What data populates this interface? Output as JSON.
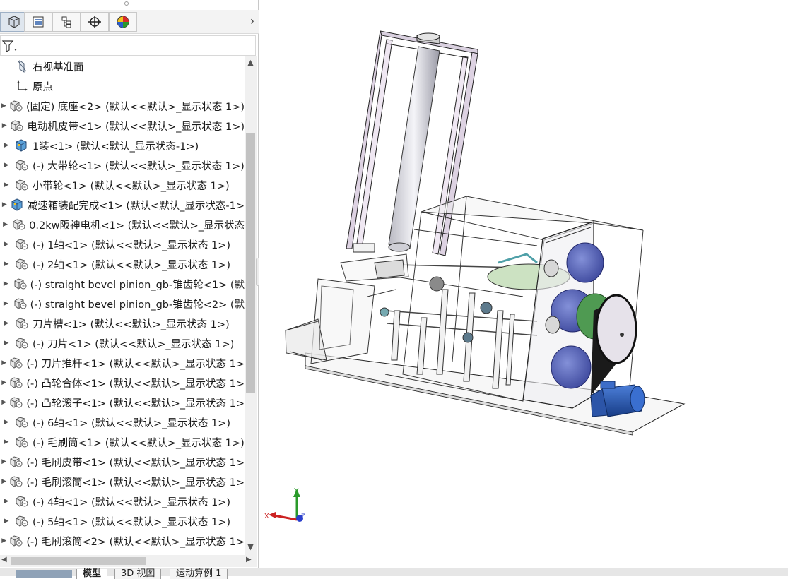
{
  "feature_tree": {
    "items": [
      {
        "label": "右视基准面",
        "icon": "plane-icon",
        "expandable": false
      },
      {
        "label": "原点",
        "icon": "origin-icon",
        "expandable": false
      },
      {
        "label": "(固定) 底座<2> (默认<<默认>_显示状态 1>)",
        "icon": "part-icon",
        "expandable": true
      },
      {
        "label": "电动机皮带<1> (默认<<默认>_显示状态 1>)",
        "icon": "part-icon",
        "expandable": true
      },
      {
        "label": "1装<1> (默认<默认_显示状态-1>)",
        "icon": "assembly-icon",
        "expandable": true
      },
      {
        "label": "(-) 大带轮<1> (默认<<默认>_显示状态 1>)",
        "icon": "part-icon",
        "expandable": true
      },
      {
        "label": "小带轮<1> (默认<<默认>_显示状态 1>)",
        "icon": "part-icon",
        "expandable": true
      },
      {
        "label": "减速箱装配完成<1> (默认<默认_显示状态-1>",
        "icon": "assembly-icon",
        "expandable": true
      },
      {
        "label": "0.2kw阪神电机<1> (默认<<默认>_显示状态",
        "icon": "part-icon",
        "expandable": true
      },
      {
        "label": "(-) 1轴<1> (默认<<默认>_显示状态 1>)",
        "icon": "part-icon",
        "expandable": true
      },
      {
        "label": "(-) 2轴<1> (默认<<默认>_显示状态 1>)",
        "icon": "part-icon",
        "expandable": true
      },
      {
        "label": "(-) straight bevel pinion_gb-锥齿轮<1> (默",
        "icon": "part-icon",
        "expandable": true
      },
      {
        "label": "(-) straight bevel pinion_gb-锥齿轮<2> (默",
        "icon": "part-icon",
        "expandable": true
      },
      {
        "label": "刀片槽<1> (默认<<默认>_显示状态 1>)",
        "icon": "part-icon",
        "expandable": true
      },
      {
        "label": "(-) 刀片<1> (默认<<默认>_显示状态 1>)",
        "icon": "part-icon",
        "expandable": true
      },
      {
        "label": "(-) 刀片推杆<1> (默认<<默认>_显示状态 1>",
        "icon": "part-icon",
        "expandable": true
      },
      {
        "label": "(-) 凸轮合体<1> (默认<<默认>_显示状态 1>",
        "icon": "part-icon",
        "expandable": true
      },
      {
        "label": "(-) 凸轮滚子<1> (默认<<默认>_显示状态 1>",
        "icon": "part-icon",
        "expandable": true
      },
      {
        "label": "(-) 6轴<1> (默认<<默认>_显示状态 1>)",
        "icon": "part-icon",
        "expandable": true
      },
      {
        "label": "(-) 毛刷筒<1> (默认<<默认>_显示状态 1>)",
        "icon": "part-icon",
        "expandable": true
      },
      {
        "label": "(-) 毛刷皮带<1> (默认<<默认>_显示状态 1>",
        "icon": "part-icon",
        "expandable": true
      },
      {
        "label": "(-) 毛刷滚筒<1> (默认<<默认>_显示状态 1>",
        "icon": "part-icon",
        "expandable": true
      },
      {
        "label": "(-) 4轴<1> (默认<<默认>_显示状态 1>)",
        "icon": "part-icon",
        "expandable": true
      },
      {
        "label": "(-) 5轴<1> (默认<<默认>_显示状态 1>)",
        "icon": "part-icon",
        "expandable": true
      },
      {
        "label": "(-) 毛刷滚筒<2> (默认<<默认>_显示状态 1>",
        "icon": "part-icon",
        "expandable": true
      }
    ]
  },
  "bottom_tabs": [
    {
      "label": "模型",
      "active": true
    },
    {
      "label": "3D 视图",
      "active": false
    },
    {
      "label": "运动算例 1",
      "active": false
    }
  ],
  "triad": {
    "x": "X",
    "y": "Y",
    "z": "Z"
  },
  "colors": {
    "x_axis": "#cc2222",
    "y_axis": "#2a9a2a",
    "z_axis": "#2a3fcc",
    "motor": "#1f4fb0",
    "gear": "#3c4fb5"
  }
}
